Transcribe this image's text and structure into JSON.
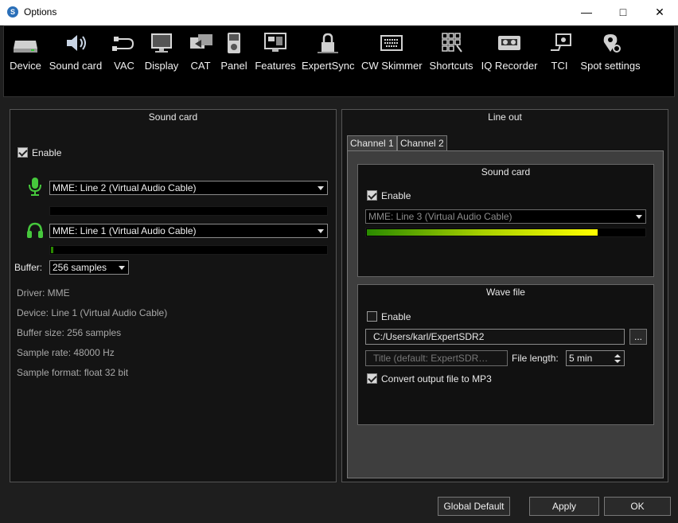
{
  "window": {
    "title": "Options"
  },
  "toolbar": {
    "items": [
      {
        "label": "Device",
        "icon": "device-icon"
      },
      {
        "label": "Sound card",
        "icon": "speaker-icon"
      },
      {
        "label": "VAC",
        "icon": "cable-icon"
      },
      {
        "label": "Display",
        "icon": "monitor-icon"
      },
      {
        "label": "CAT",
        "icon": "cat-icon"
      },
      {
        "label": "Panel",
        "icon": "panel-icon"
      },
      {
        "label": "Features",
        "icon": "features-icon"
      },
      {
        "label": "ExpertSync",
        "icon": "lock-icon"
      },
      {
        "label": "CW Skimmer",
        "icon": "keyboard-icon"
      },
      {
        "label": "Shortcuts",
        "icon": "shortcuts-icon"
      },
      {
        "label": "IQ Recorder",
        "icon": "cassette-icon"
      },
      {
        "label": "TCI",
        "icon": "tci-icon"
      },
      {
        "label": "Spot settings",
        "icon": "spot-icon"
      }
    ]
  },
  "soundcard": {
    "title": "Sound card",
    "enable_label": "Enable",
    "enabled": true,
    "input_device": "MME: Line 2 (Virtual Audio Cable)",
    "input_level": 0,
    "output_device": "MME: Line 1 (Virtual Audio Cable)",
    "output_level": 0.01,
    "buffer_label": "Buffer:",
    "buffer_value": "256 samples",
    "info": {
      "driver": "Driver: MME",
      "device": "Device: Line 1 (Virtual Audio Cable)",
      "buffer_size": "Buffer size: 256 samples",
      "sample_rate": "Sample rate: 48000 Hz",
      "sample_format": "Sample format: float 32 bit"
    }
  },
  "lineout": {
    "title": "Line out",
    "tabs": [
      "Channel 1",
      "Channel 2"
    ],
    "active_tab": 0,
    "soundcard": {
      "title": "Sound card",
      "enable_label": "Enable",
      "enabled": true,
      "device": "MME: Line 3 (Virtual Audio Cable)",
      "level": 0.83
    },
    "wavefile": {
      "title": "Wave file",
      "enable_label": "Enable",
      "enabled": false,
      "path": "C:/Users/karl/ExpertSDR2",
      "browse_label": "...",
      "title_placeholder": "Title (default: ExpertSDR…",
      "file_length_label": "File length:",
      "file_length_value": "5 min",
      "mp3_label": "Convert output file to MP3",
      "mp3_enabled": true
    }
  },
  "footer": {
    "global_default": "Global Default",
    "apply": "Apply",
    "ok": "OK"
  },
  "colors": {
    "mic": "#46c83c",
    "headphones": "#46c83c",
    "meter_low": "#2a8a00",
    "meter_high": "#ffff00"
  }
}
